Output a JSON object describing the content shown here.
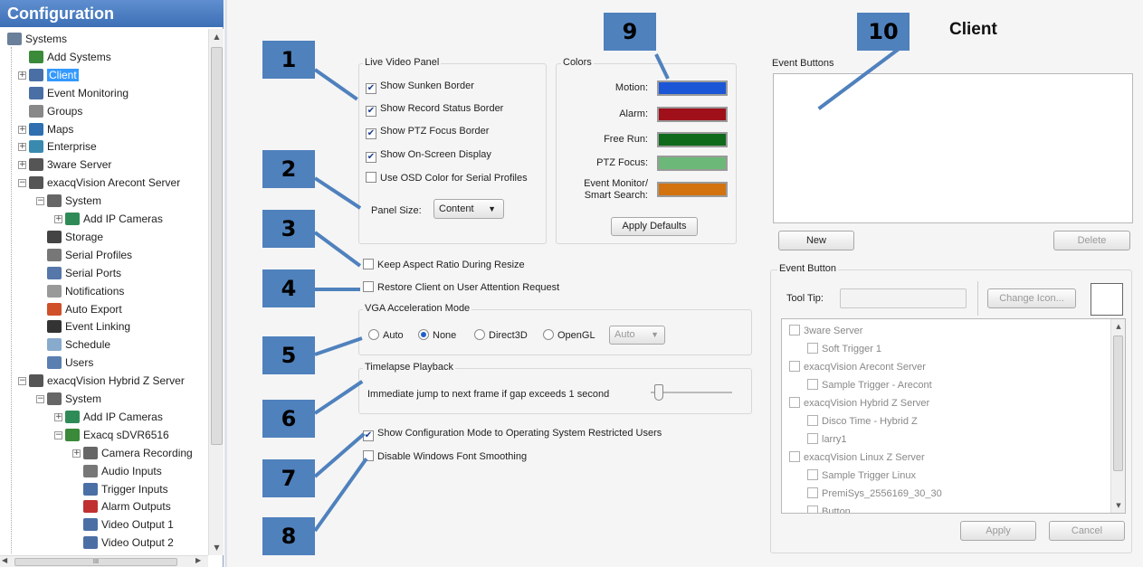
{
  "left_panel": {
    "title": "Configuration",
    "tree": [
      {
        "label": "Systems",
        "indent": 0,
        "icon": "systems-icon",
        "color": "#6a7f9a"
      },
      {
        "label": "Add Systems",
        "indent": 1,
        "icon": "add-systems-icon",
        "color": "#3a8a3a"
      },
      {
        "label": "Client",
        "indent": 1,
        "icon": "client-gear-icon",
        "color": "#4a6fa5",
        "selected": true
      },
      {
        "label": "Event Monitoring",
        "indent": 1,
        "icon": "event-monitoring-icon",
        "color": "#4a6fa5"
      },
      {
        "label": "Groups",
        "indent": 1,
        "icon": "groups-icon",
        "color": "#888888"
      },
      {
        "label": "Maps",
        "indent": 1,
        "icon": "maps-icon",
        "color": "#2f6fb0"
      },
      {
        "label": "Enterprise",
        "indent": 1,
        "icon": "enterprise-icon",
        "color": "#3a8ab0"
      },
      {
        "label": "3ware Server",
        "indent": 1,
        "icon": "server-icon",
        "color": "#555555"
      },
      {
        "label": "exacqVision Arecont Server",
        "indent": 1,
        "icon": "server-icon",
        "color": "#555555"
      },
      {
        "label": "System",
        "indent": 2,
        "icon": "system-icon",
        "color": "#666666"
      },
      {
        "label": "Add IP Cameras",
        "indent": 3,
        "icon": "add-ip-cameras-icon",
        "color": "#2e8b57"
      },
      {
        "label": "Storage",
        "indent": 2,
        "icon": "storage-icon",
        "color": "#444444"
      },
      {
        "label": "Serial Profiles",
        "indent": 2,
        "icon": "serial-profiles-icon",
        "color": "#777777"
      },
      {
        "label": "Serial Ports",
        "indent": 2,
        "icon": "serial-ports-icon",
        "color": "#5577aa"
      },
      {
        "label": "Notifications",
        "indent": 2,
        "icon": "notifications-icon",
        "color": "#999999"
      },
      {
        "label": "Auto Export",
        "indent": 2,
        "icon": "auto-export-icon",
        "color": "#d0502a"
      },
      {
        "label": "Event Linking",
        "indent": 2,
        "icon": "event-linking-icon",
        "color": "#333333"
      },
      {
        "label": "Schedule",
        "indent": 2,
        "icon": "schedule-icon",
        "color": "#88aacc"
      },
      {
        "label": "Users",
        "indent": 2,
        "icon": "users-icon",
        "color": "#5a7fb0"
      },
      {
        "label": "exacqVision Hybrid Z Server",
        "indent": 1,
        "icon": "server-icon",
        "color": "#555555"
      },
      {
        "label": "System",
        "indent": 2,
        "icon": "system-icon",
        "color": "#666666"
      },
      {
        "label": "Add IP Cameras",
        "indent": 3,
        "icon": "add-ip-cameras-icon",
        "color": "#2e8b57"
      },
      {
        "label": "Exacq sDVR6516",
        "indent": 3,
        "icon": "dvr-icon",
        "color": "#3a8a3a"
      },
      {
        "label": "Camera Recording",
        "indent": 4,
        "icon": "camera-recording-icon",
        "color": "#666666"
      },
      {
        "label": "Audio Inputs",
        "indent": 4,
        "icon": "audio-inputs-icon",
        "color": "#777777"
      },
      {
        "label": "Trigger Inputs",
        "indent": 4,
        "icon": "trigger-inputs-icon",
        "color": "#4a6fa5"
      },
      {
        "label": "Alarm Outputs",
        "indent": 4,
        "icon": "alarm-outputs-icon",
        "color": "#c03030"
      },
      {
        "label": "Video Output 1",
        "indent": 4,
        "icon": "video-output-icon",
        "color": "#4a6fa5"
      },
      {
        "label": "Video Output 2",
        "indent": 4,
        "icon": "video-output-icon",
        "color": "#4a6fa5"
      }
    ]
  },
  "page_title": "Client",
  "live_video_panel": {
    "title": "Live Video Panel",
    "options": [
      {
        "label": "Show Sunken Border",
        "checked": true
      },
      {
        "label": "Show Record Status Border",
        "checked": true
      },
      {
        "label": "Show PTZ Focus Border",
        "checked": true
      },
      {
        "label": "Show On-Screen Display",
        "checked": true
      },
      {
        "label": "Use OSD Color for Serial Profiles",
        "checked": false
      }
    ],
    "panel_size_label": "Panel Size:",
    "panel_size_value": "Content"
  },
  "colors": {
    "title": "Colors",
    "items": [
      {
        "label": "Motion:",
        "color": "#1a56d6"
      },
      {
        "label": "Alarm:",
        "color": "#a0101a"
      },
      {
        "label": "Free Run:",
        "color": "#0f6a1c"
      },
      {
        "label": "PTZ Focus:",
        "color": "#6cb878"
      },
      {
        "label_line1": "Event Monitor/",
        "label_line2": "Smart Search:",
        "color": "#d2730f"
      }
    ],
    "apply_defaults": "Apply Defaults"
  },
  "options": {
    "keep_aspect": "Keep Aspect Ratio During Resize",
    "restore_client": "Restore Client on User Attention Request",
    "show_config_mode": "Show Configuration Mode to Operating System Restricted Users",
    "disable_font_smoothing": "Disable Windows Font Smoothing"
  },
  "vga": {
    "title": "VGA Acceleration Mode",
    "radios": [
      "Auto",
      "None",
      "Direct3D",
      "OpenGL"
    ],
    "selected": "None",
    "dropdown_value": "Auto"
  },
  "timelapse": {
    "title": "Timelapse Playback",
    "text": "Immediate jump to next frame if gap exceeds 1 second"
  },
  "event_buttons": {
    "title": "Event Buttons",
    "new_label": "New",
    "delete_label": "Delete",
    "event_button_title": "Event Button",
    "tooltip_label": "Tool Tip:",
    "change_icon_label": "Change Icon...",
    "tree": [
      {
        "label": "3ware Server",
        "indent": 0
      },
      {
        "label": "Soft Trigger 1",
        "indent": 1
      },
      {
        "label": "exacqVision Arecont Server",
        "indent": 0
      },
      {
        "label": "Sample Trigger - Arecont",
        "indent": 1
      },
      {
        "label": "exacqVision Hybrid Z Server",
        "indent": 0
      },
      {
        "label": "Disco Time - Hybrid Z",
        "indent": 1
      },
      {
        "label": "larry1",
        "indent": 1
      },
      {
        "label": "exacqVision Linux Z Server",
        "indent": 0
      },
      {
        "label": "Sample Trigger Linux",
        "indent": 1
      },
      {
        "label": "PremiSys_2556169_30_30",
        "indent": 1
      },
      {
        "label": "Button",
        "indent": 1
      }
    ],
    "apply_label": "Apply",
    "cancel_label": "Cancel"
  },
  "callouts": [
    "1",
    "2",
    "3",
    "4",
    "5",
    "6",
    "7",
    "8",
    "9",
    "10"
  ],
  "accent_color": "#4f81bd",
  "horizontal_scroll_thumb": "III"
}
